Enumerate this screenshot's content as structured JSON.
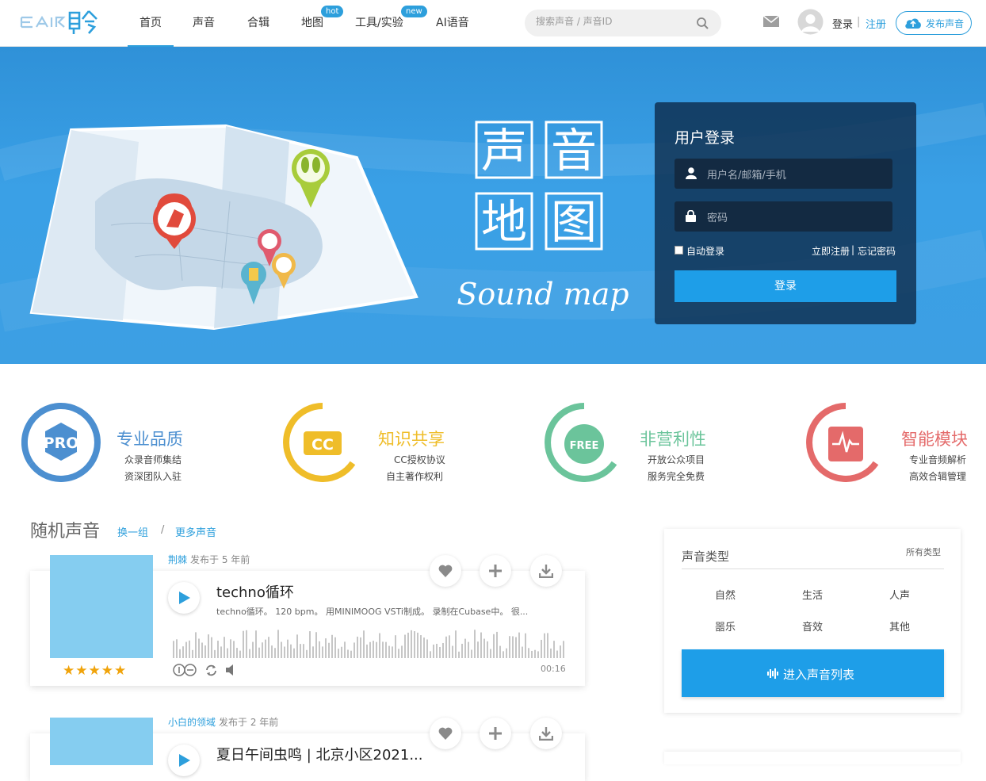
{
  "nav": {
    "logo_text": "EAIR聆",
    "items": [
      {
        "label": "首页"
      },
      {
        "label": "声音"
      },
      {
        "label": "合辑"
      },
      {
        "label": "地图",
        "badge": "hot"
      },
      {
        "label": "工具/实验",
        "badge": "new"
      },
      {
        "label": "AI语音"
      }
    ],
    "search_placeholder": "搜索声音 / 声音ID",
    "login": "登录",
    "separator": "|",
    "register": "注册",
    "publish": "发布声音"
  },
  "hero": {
    "title_chars": [
      "声",
      "音",
      "地",
      "图"
    ],
    "subtitle": "Sound map",
    "login": {
      "title": "用户登录",
      "username_placeholder": "用户名/邮箱/手机",
      "password_placeholder": "密码",
      "auto_login": "自动登录",
      "register_now": "立即注册",
      "forgot": "忘记密码",
      "link_sep": "|",
      "submit": "登录"
    }
  },
  "features": [
    {
      "icon": "PRO",
      "title": "专业品质",
      "line1": "众录音师集结",
      "line2": "资深团队入驻",
      "color": "#4c8fd0"
    },
    {
      "icon": "CC",
      "title": "知识共享",
      "line1": "CC授权协议",
      "line2": "自主著作权利",
      "color": "#efbd29"
    },
    {
      "icon": "FREE",
      "title": "非营利性",
      "line1": "开放公众项目",
      "line2": "服务完全免费",
      "color": "#6bc49b"
    },
    {
      "icon": "pulse",
      "title": "智能模块",
      "line1": "专业音频解析",
      "line2": "高效合辑管理",
      "color": "#e46a6a"
    }
  ],
  "random": {
    "title": "随机声音",
    "switch": "换一组",
    "slash": "/",
    "more": "更多声音"
  },
  "sounds": [
    {
      "author": "荆棘",
      "published": "发布于 5 年前",
      "title": "techno循环",
      "desc": "techno循环。 120 bpm。 用MINIMOOG VSTi制成。 录制在Cubase中。 很...",
      "duration": "00:16",
      "rating": 5
    },
    {
      "author": "小白的领域",
      "published": "发布于 2 年前",
      "title": "夏日午间虫鸣 | 北京小区2021...",
      "desc": "",
      "duration": "",
      "rating": 0
    }
  ],
  "types": {
    "title": "声音类型",
    "all": "所有类型",
    "items": [
      "自然",
      "生活",
      "人声",
      "噐乐",
      "音效",
      "其他"
    ],
    "enter": "进入声音列表"
  },
  "colors": {
    "accent": "#2d9fdc",
    "star": "#f0a30a"
  }
}
